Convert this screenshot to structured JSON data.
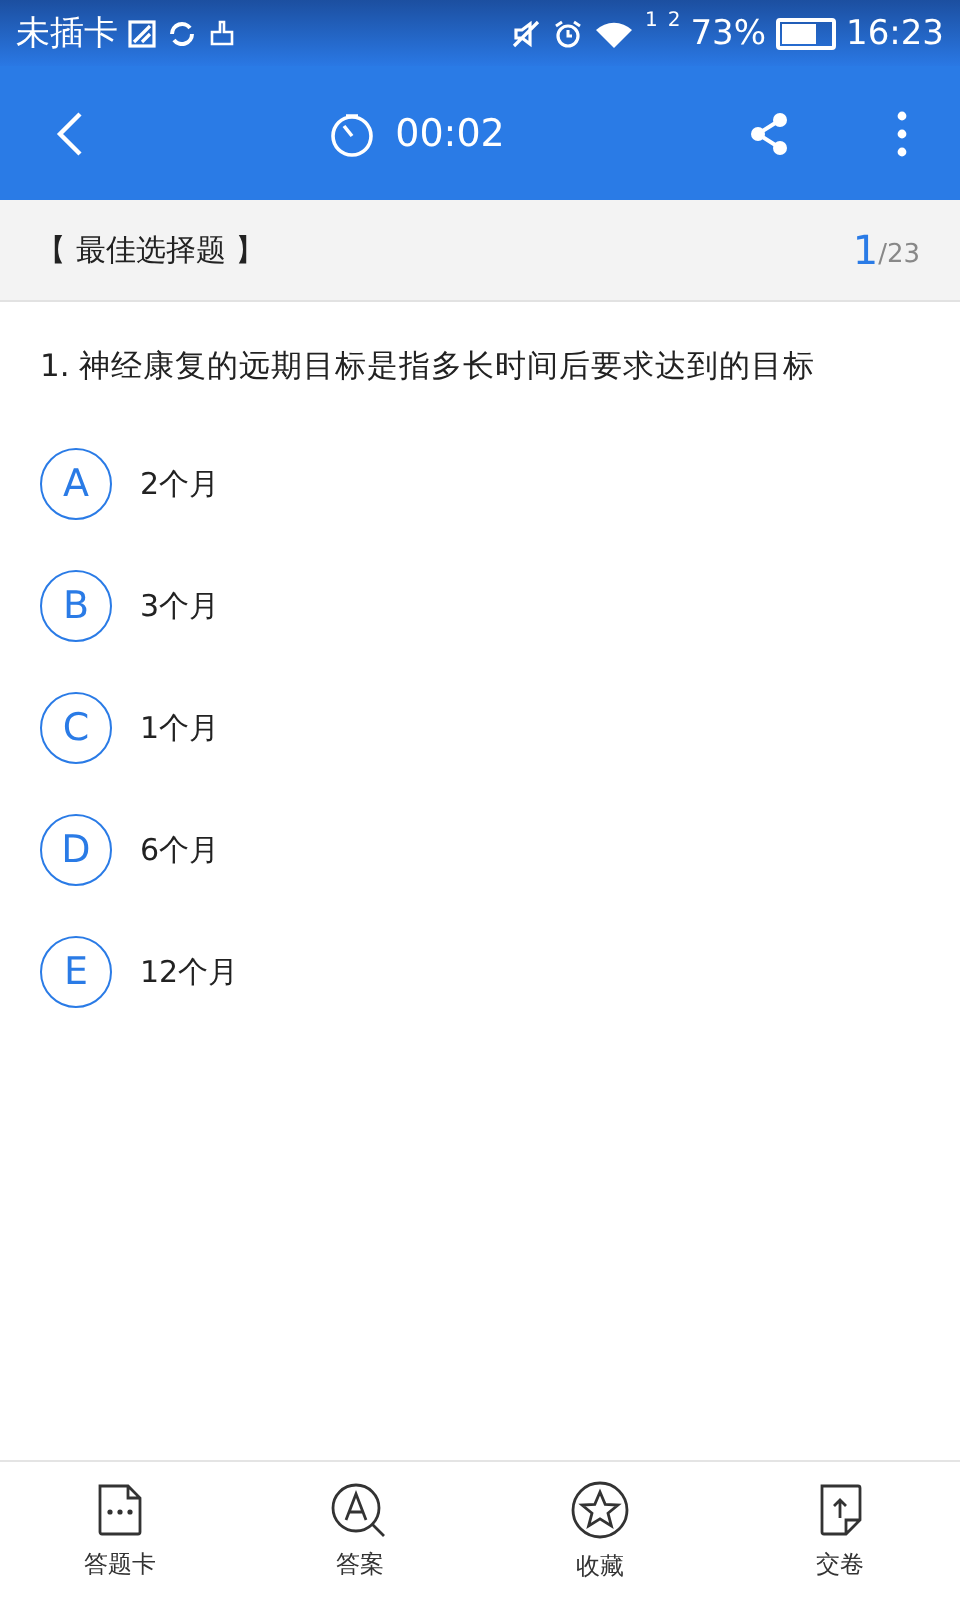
{
  "status_bar": {
    "carrier": "未插卡",
    "battery_percent": "73%",
    "time": "16:23",
    "sim_labels": [
      "1",
      "2"
    ]
  },
  "app_bar": {
    "timer": "00:02"
  },
  "section": {
    "title": "【 最佳选择题 】",
    "current": "1",
    "total": "/23"
  },
  "question": {
    "text": "1. 神经康复的远期目标是指多长时间后要求达到的目标"
  },
  "options": [
    {
      "letter": "A",
      "text": "2个月"
    },
    {
      "letter": "B",
      "text": "3个月"
    },
    {
      "letter": "C",
      "text": "1个月"
    },
    {
      "letter": "D",
      "text": "6个月"
    },
    {
      "letter": "E",
      "text": "12个月"
    }
  ],
  "bottom_nav": [
    {
      "kind": "card",
      "label": "答题卡"
    },
    {
      "kind": "answer",
      "label": "答案"
    },
    {
      "kind": "favorite",
      "label": "收藏"
    },
    {
      "kind": "submit",
      "label": "交卷"
    }
  ]
}
